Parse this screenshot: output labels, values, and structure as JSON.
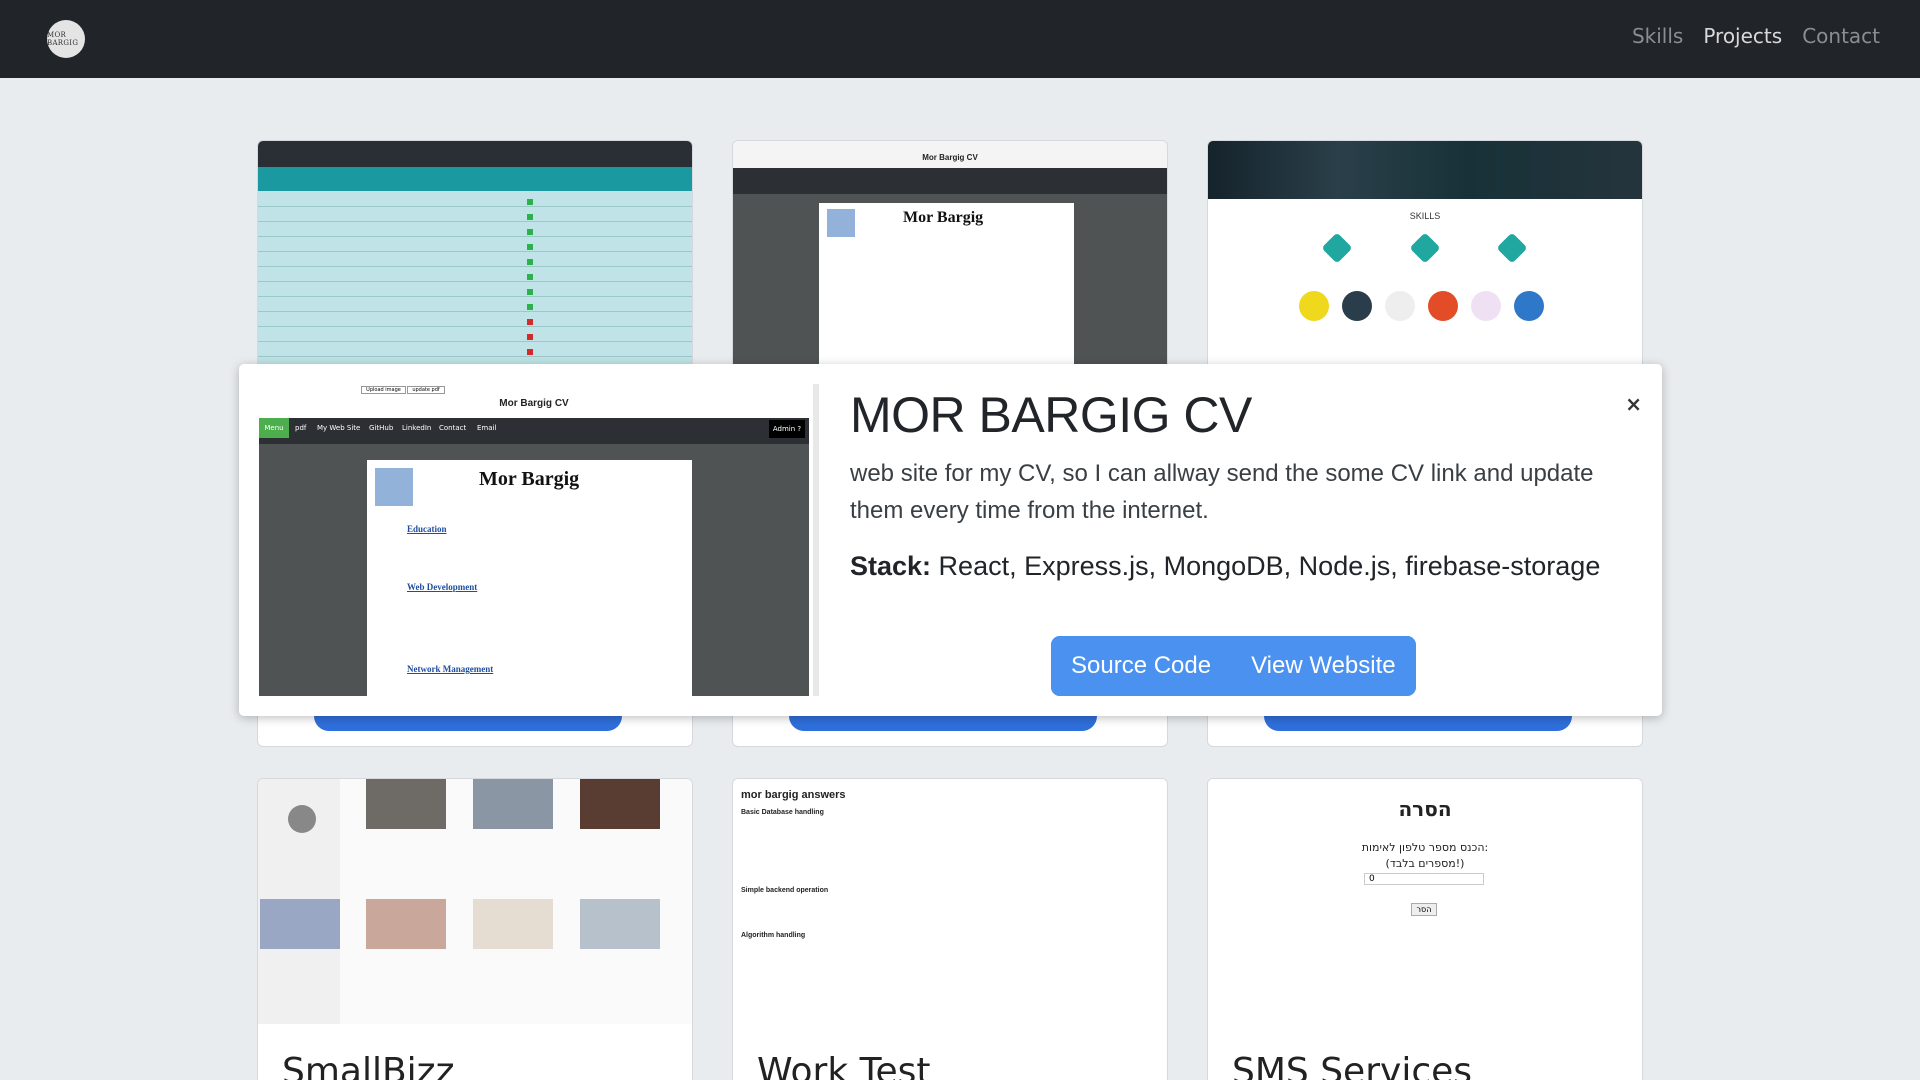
{
  "navbar": {
    "logo_text": "MOR BARGIG",
    "links": [
      "Skills",
      "Projects",
      "Contact"
    ]
  },
  "cards": [
    {
      "title": "",
      "thumb": "admin-table"
    },
    {
      "title": "",
      "thumb": "cv-viewer"
    },
    {
      "title": "",
      "thumb": "skills"
    },
    {
      "title": "SmallBizz"
    },
    {
      "title": "Work Test"
    },
    {
      "title": "SMS Services"
    }
  ],
  "thumbs": {
    "cv_title": "Mor Bargig CV",
    "cv_name": "Mor Bargig",
    "skills_label": "SKILLS",
    "work_test_heading": "mor bargig answers",
    "work_test_sections": [
      "Basic Database handling",
      "Simple backend operation",
      "Algorithm handling"
    ],
    "sms_heading": "הסרה",
    "sms_prompt": "הכנס מספר טלפון לאימות:",
    "sms_note": "(מספרים בלבד!)",
    "sms_value": "0",
    "sms_button": "הסר"
  },
  "modal": {
    "title": "MOR BARGIG CV",
    "description": "web site for my CV, so I can allway send the some CV link and update them every time from the internet.",
    "stack_label": "Stack:",
    "stack_value": " React, Express.js, MongoDB, Node.js, firebase-storage",
    "source_button": "Source Code",
    "view_button": "View Website",
    "close_label": "×",
    "preview": {
      "title": "Mor Bargig CV",
      "menu": [
        "Menu",
        "pdf",
        "My Web Site",
        "GitHub",
        "LinkedIn",
        "Contact",
        "Email"
      ],
      "admin": "Admin ?",
      "upload_image": "Upload image",
      "update_pdf": "update pdf",
      "cv_name": "Mor Bargig",
      "sections": [
        "Education",
        "Web Development",
        "Network Management"
      ]
    }
  },
  "colors": {
    "navbar": "#212529",
    "page_bg": "#e9ecef",
    "primary_button": "#4a91f0",
    "card_button": "#2f6fdc"
  }
}
